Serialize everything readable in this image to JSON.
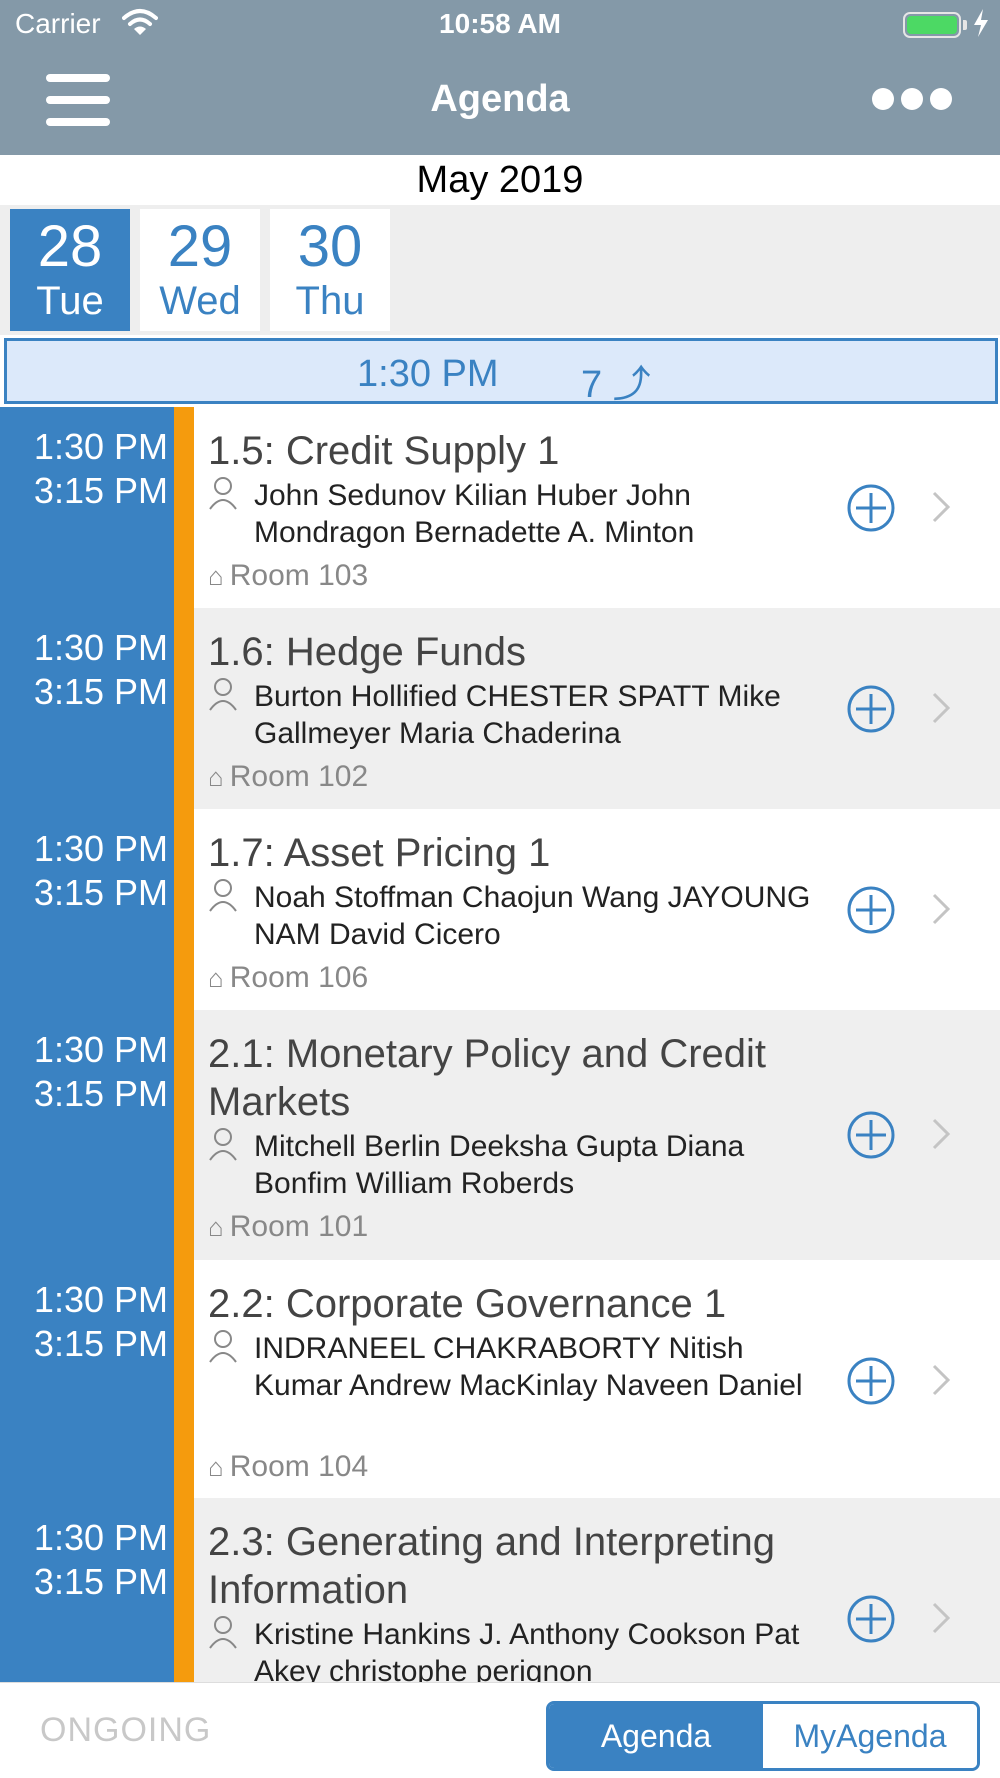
{
  "status_bar": {
    "carrier": "Carrier",
    "time": "10:58 AM"
  },
  "nav": {
    "title": "Agenda"
  },
  "calendar": {
    "month": "May 2019",
    "days": [
      {
        "num": "28",
        "dow": "Tue",
        "active": true
      },
      {
        "num": "29",
        "dow": "Wed",
        "active": false
      },
      {
        "num": "30",
        "dow": "Thu",
        "active": false
      }
    ]
  },
  "banner": {
    "time": "1:30 PM",
    "count": "7 ⤴"
  },
  "sessions": [
    {
      "start": "1:30 PM",
      "end": "3:15 PM",
      "title": "1.5: Credit Supply 1",
      "speakers": "John Sedunov Kilian Huber John Mondragon Bernadette A. Minton",
      "room": "Room 103"
    },
    {
      "start": "1:30 PM",
      "end": "3:15 PM",
      "title": "1.6: Hedge Funds",
      "speakers": "Burton Hollified CHESTER SPATT Mike Gallmeyer Maria Chaderina",
      "room": "Room 102"
    },
    {
      "start": "1:30 PM",
      "end": "3:15 PM",
      "title": "1.7: Asset Pricing 1",
      "speakers": "Noah Stoffman Chaojun Wang JAYOUNG NAM David Cicero",
      "room": "Room 106"
    },
    {
      "start": "1:30 PM",
      "end": "3:15 PM",
      "title": "2.1: Monetary Policy and Credit Markets",
      "speakers": "Mitchell Berlin Deeksha Gupta Diana Bonfim William Roberds",
      "room": "Room 101"
    },
    {
      "start": "1:30 PM",
      "end": "3:15 PM",
      "title": "2.2: Corporate Governance 1",
      "speakers": "INDRANEEL CHAKRABORTY Nitish Kumar Andrew MacKinlay Naveen Daniel",
      "room": "Room 104"
    },
    {
      "start": "1:30 PM",
      "end": "3:15 PM",
      "title": "2.3: Generating and Interpreting Information",
      "speakers": "Kristine Hankins J. Anthony Cookson Pat Akey christophe perignon",
      "room": ""
    }
  ],
  "bottom": {
    "ongoing": "ONGOING",
    "tab_agenda": "Agenda",
    "tab_myagenda": "MyAgenda"
  },
  "colors": {
    "accent": "#3a82c2",
    "nav_bg": "#8499a8",
    "time_marker": "#f59b0d"
  }
}
